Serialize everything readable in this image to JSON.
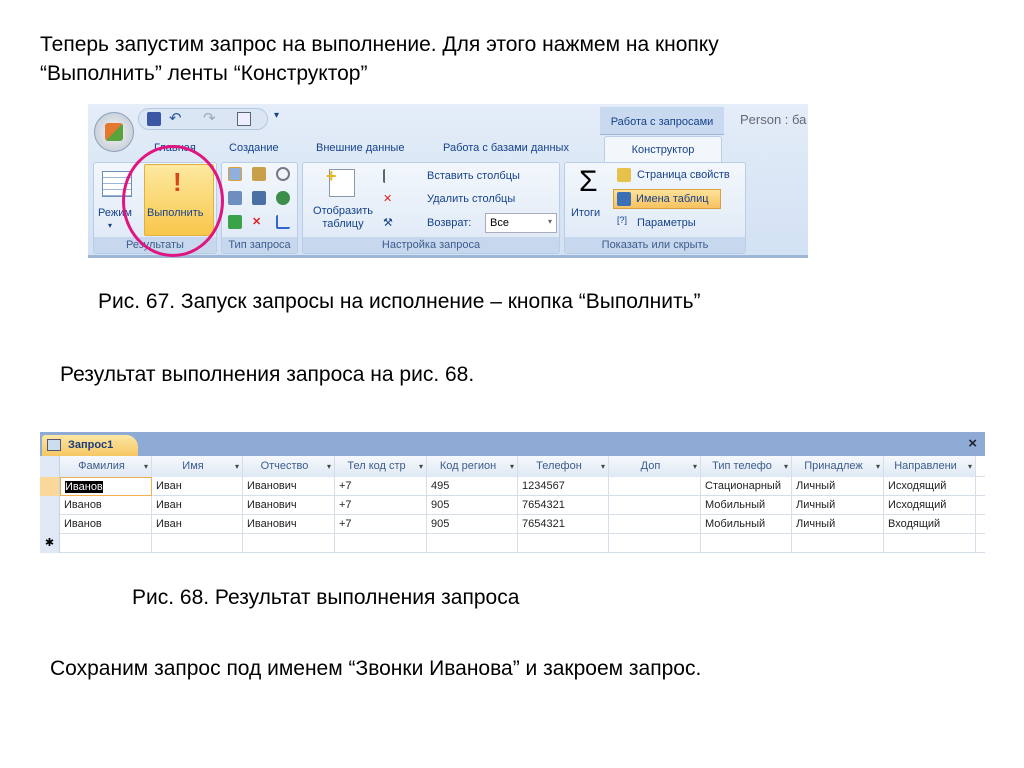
{
  "slide": {
    "intro_line1": "Теперь запустим запрос на выполнение. Для этого нажмем на кнопку",
    "intro_line2": "“Выполнить” ленты “Конструктор”",
    "caption67": "Рис. 67. Запуск запросы на исполнение – кнопка “Выполнить”",
    "result_text": "Результат выполнения запроса на рис. 68.",
    "caption68": "Рис. 68. Результат выполнения запроса",
    "outro": "Сохраним запрос под именем “Звонки Иванова” и закроем запрос."
  },
  "ribbon": {
    "context_tab": "Работа с запросами",
    "window_title": "Person : ба",
    "tabs": [
      "Главная",
      "Создание",
      "Внешние данные",
      "Работа с базами данных",
      "Конструктор"
    ],
    "active_tab": "Конструктор",
    "groups": {
      "results": {
        "label": "Результаты",
        "mode": "Режим",
        "run": "Выполнить"
      },
      "query_type": {
        "label": "Тип запроса"
      },
      "setup": {
        "label": "Настройка запроса",
        "show_table_1": "Отобразить",
        "show_table_2": "таблицу",
        "insert_cols": "Вставить столбцы",
        "delete_cols": "Удалить столбцы",
        "return_label": "Возврат:",
        "return_value": "Все"
      },
      "show_hide": {
        "label": "Показать или скрыть",
        "totals": "Итоги",
        "property_sheet": "Страница свойств",
        "table_names": "Имена таблиц",
        "parameters": "Параметры"
      }
    },
    "highlight_color": "#e0157f"
  },
  "grid": {
    "tab": "Запрос1",
    "close": "×",
    "columns": [
      "Фамилия",
      "Имя",
      "Отчество",
      "Тел код стр",
      "Код регион",
      "Телефон",
      "Доп",
      "Тип телефо",
      "Принадлеж",
      "Направлени"
    ],
    "rows": [
      [
        "Иванов",
        "Иван",
        "Иванович",
        "+7",
        "495",
        "1234567",
        "",
        "Стационарный",
        "Личный",
        "Исходящий"
      ],
      [
        "Иванов",
        "Иван",
        "Иванович",
        "+7",
        "905",
        "7654321",
        "",
        "Мобильный",
        "Личный",
        "Исходящий"
      ],
      [
        "Иванов",
        "Иван",
        "Иванович",
        "+7",
        "905",
        "7654321",
        "",
        "Мобильный",
        "Личный",
        "Входящий"
      ]
    ],
    "new_row_marker": "✱"
  }
}
